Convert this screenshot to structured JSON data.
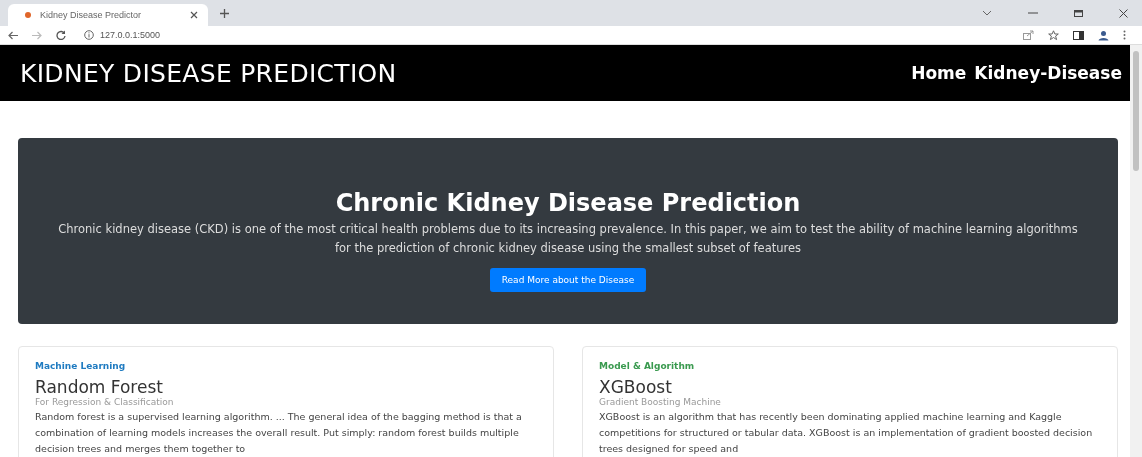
{
  "browser": {
    "tab_title": "Kidney Disease Predictor",
    "url": "127.0.0.1:5000"
  },
  "navbar": {
    "brand": "KIDNEY DISEASE PREDICTION",
    "links": [
      "Home",
      "Kidney-Disease"
    ]
  },
  "hero": {
    "title": "Chronic Kidney Disease Prediction",
    "text": "Chronic kidney disease (CKD) is one of the most critical health problems due to its increasing prevalence. In this paper, we aim to test the ability of machine learning algorithms for the prediction of chronic kidney disease using the smallest subset of features",
    "button": "Read More about the Disease"
  },
  "cards": [
    {
      "category": "Machine Learning",
      "color": "#1f7bc1",
      "title": "Random Forest",
      "subtitle": "For Regression & Classification",
      "text": "Random forest is a supervised learning algorithm. ... The general idea of the bagging method is that a combination of learning models increases the overall result. Put simply: random forest builds multiple decision trees and merges them together to"
    },
    {
      "category": "Model & Algorithm",
      "color": "#3a9a4f",
      "title": "XGBoost",
      "subtitle": "Gradient Boosting Machine",
      "text": "XGBoost is an algorithm that has recently been dominating applied machine learning and Kaggle competitions for structured or tabular data. XGBoost is an implementation of gradient boosted decision trees designed for speed and"
    }
  ]
}
